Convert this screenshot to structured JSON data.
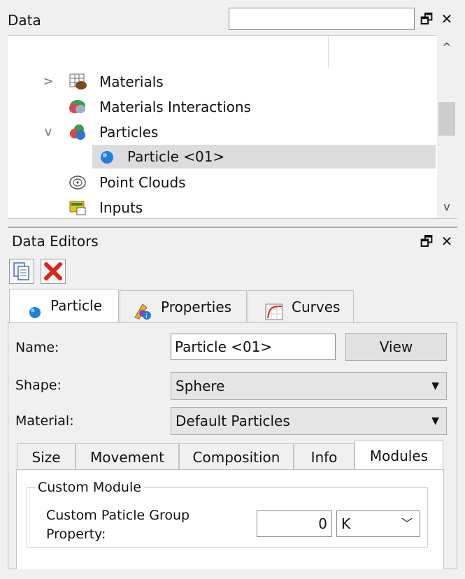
{
  "data_panel": {
    "title": "Data",
    "search": {
      "value": "",
      "placeholder": ""
    },
    "float_icon": "🗗",
    "close_icon": "✕",
    "sort_indicator": "^",
    "tree": [
      {
        "label": "Materials",
        "arrow": ">",
        "icon": "materials-icon"
      },
      {
        "label": "Materials Interactions",
        "arrow": "",
        "icon": "materials-interactions-icon"
      },
      {
        "label": "Particles",
        "arrow": "v",
        "icon": "particles-icon"
      },
      {
        "label": "Particle <01>",
        "arrow": "",
        "icon": "particle-sphere-icon",
        "selected": true
      },
      {
        "label": "Point Clouds",
        "arrow": "",
        "icon": "point-clouds-icon"
      },
      {
        "label": "Inputs",
        "arrow": "",
        "icon": "inputs-icon"
      }
    ],
    "scroll_up": "^",
    "scroll_down": "v"
  },
  "editors_panel": {
    "title": "Data Editors",
    "float_icon": "🗗",
    "close_icon": "✕",
    "toolbar": {
      "copy_icon": "copy-icon",
      "delete_icon": "delete-icon"
    },
    "tabs": [
      {
        "label": "Particle",
        "active": true
      },
      {
        "label": "Properties",
        "active": false
      },
      {
        "label": "Curves",
        "active": false
      }
    ],
    "form": {
      "name_label": "Name:",
      "name_value": "Particle <01>",
      "view_button": "View",
      "shape_label": "Shape:",
      "shape_value": "Sphere",
      "material_label": "Material:",
      "material_value": "Default Particles"
    },
    "subtabs": [
      {
        "label": "Size",
        "active": false
      },
      {
        "label": "Movement",
        "active": false
      },
      {
        "label": "Composition",
        "active": false
      },
      {
        "label": "Info",
        "active": false
      },
      {
        "label": "Modules",
        "active": true
      }
    ],
    "custom_module": {
      "group_title": "Custom Module",
      "property_label": "Custom Paticle Group Property:",
      "property_value": "0",
      "unit": "K"
    }
  },
  "colors": {
    "selected_row": "#dcdcdc",
    "delete_red": "#d9261c",
    "sphere_blue": "#1e7fe0"
  }
}
